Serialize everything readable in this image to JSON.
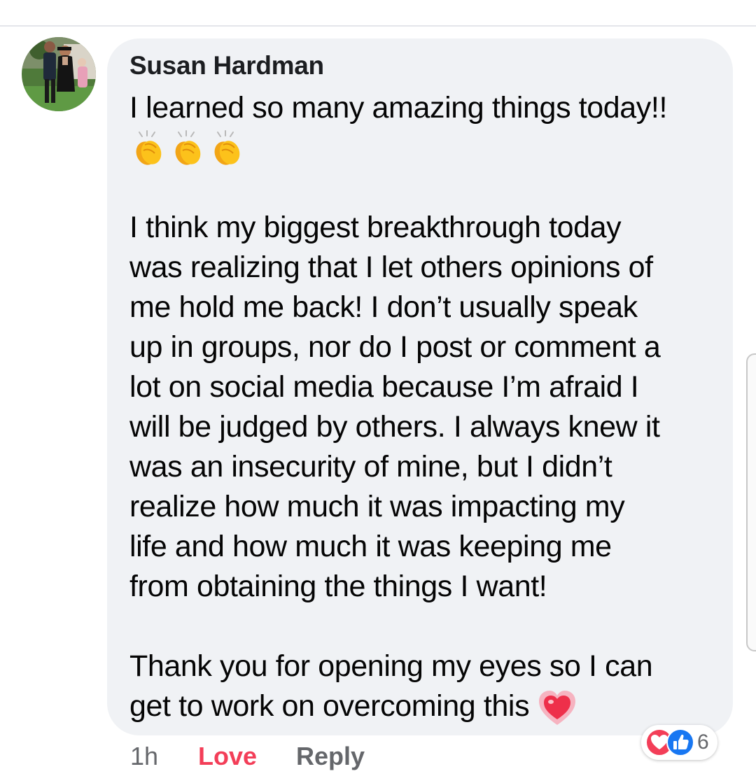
{
  "comment": {
    "author": "Susan Hardman",
    "lines": [
      "I learned so many amazing things today!!",
      "I think my biggest breakthrough today",
      "was realizing that I let others opinions of",
      "me hold me back! I don’t usually speak",
      "up in groups, nor do I post or comment a",
      "lot on social media because I’m afraid I",
      "will be judged by others. I always knew it",
      "was an insecurity of mine, but I didn’t",
      "realize how much it was impacting my",
      "life and how much it was keeping me",
      "from obtaining the things I want!",
      "Thank you for opening my eyes so I can",
      "get to work on overcoming this"
    ],
    "emojis": {
      "clapping": [
        "clapping-hands-emoji",
        "clapping-hands-emoji",
        "clapping-hands-emoji"
      ],
      "ending": "sparkling-heart-emoji"
    }
  },
  "actions": {
    "time": "1h",
    "love": "Love",
    "reply": "Reply"
  },
  "reactions": {
    "icons": [
      "love-reaction-icon",
      "like-reaction-icon"
    ],
    "count": "6"
  },
  "colors": {
    "bubble": "#f0f2f5",
    "love_active": "#f33e58",
    "secondary_text": "#65676b",
    "like_blue": "#1877f2"
  }
}
